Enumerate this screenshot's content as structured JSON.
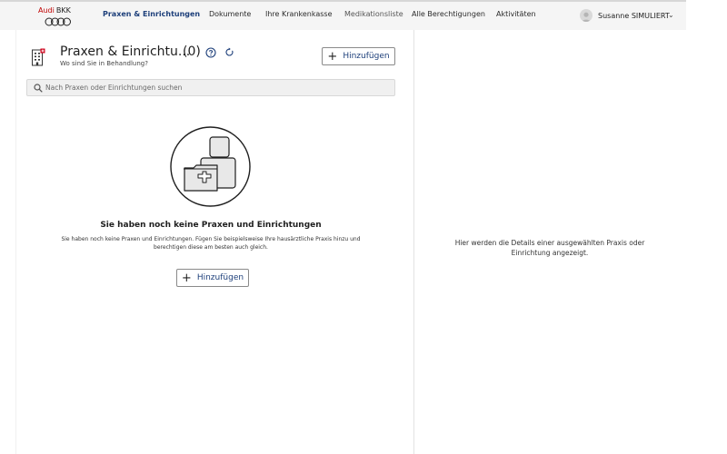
{
  "header": {
    "logo_audi": "Audi",
    "logo_bkk": "BKK",
    "nav": [
      {
        "label": "Praxen & Einrichtungen",
        "active": true
      },
      {
        "label": "Dokumente"
      },
      {
        "label": "Ihre Krankenkasse"
      },
      {
        "label": "Medikationsliste"
      },
      {
        "label": "Alle Berechtigungen"
      },
      {
        "label": "Aktivitäten"
      }
    ],
    "user_name": "Susanne SIMULIERT",
    "user_chevron": "⌄"
  },
  "main": {
    "title": "Praxen & Einrichtu...",
    "count": "(0)",
    "subtitle": "Wo sind Sie in Behandlung?",
    "add_label": "Hinzufügen",
    "search_placeholder": "Nach Praxen oder Einrichtungen suchen",
    "empty_title": "Sie haben noch keine Praxen und Einrichtungen",
    "empty_text": "Sie haben noch keine Praxen und Einrichtungen. Fügen Sie beispielsweise Ihre hausärztliche Praxis hinzu und berechtigen diese am besten auch gleich.",
    "empty_add_label": "Hinzufügen"
  },
  "details": {
    "hint": "Hier werden die Details einer ausgewählten Praxis oder Einrichtung angezeigt."
  },
  "colors": {
    "accent": "#1d3f7a",
    "brand_red": "#c00000",
    "header_bg": "#f5f5f5"
  }
}
